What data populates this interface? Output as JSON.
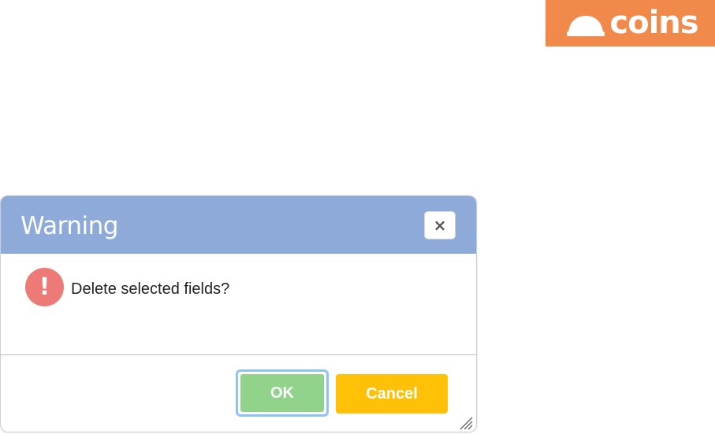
{
  "brand": {
    "logo_text": "coins",
    "color": "#f0894a"
  },
  "dialog": {
    "title": "Warning",
    "close_label": "×",
    "icon": "exclamation-icon",
    "icon_glyph": "!",
    "message": "Delete selected fields?",
    "ok_label": "OK",
    "cancel_label": "Cancel",
    "colors": {
      "header": "#8daad9",
      "ok": "#92d38b",
      "ok_focus_ring": "#8ec3f5",
      "cancel": "#ffc107",
      "warning_icon": "#ec7b78"
    }
  }
}
